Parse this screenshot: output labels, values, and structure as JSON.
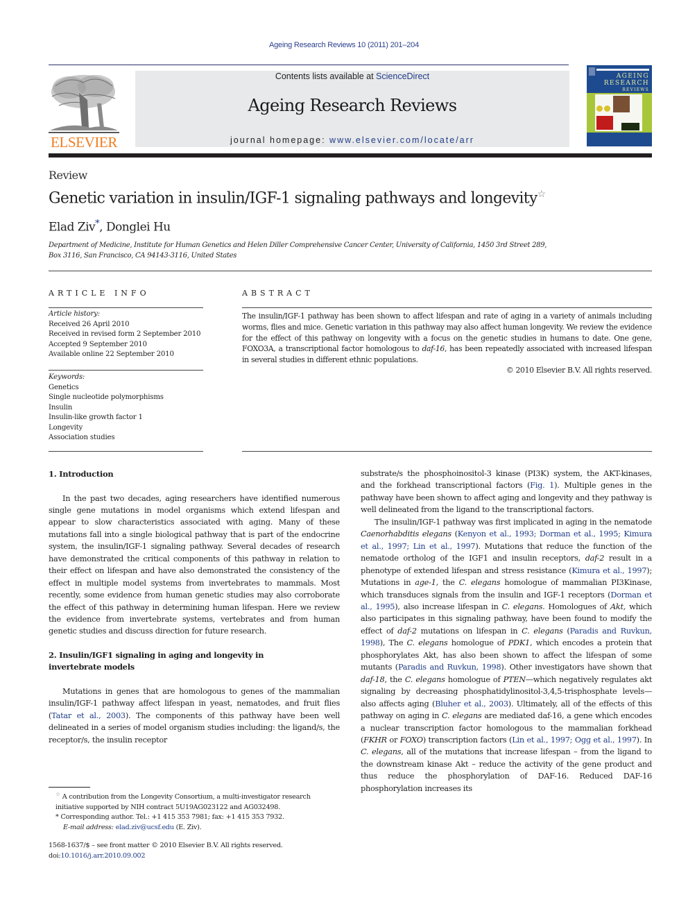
{
  "header": {
    "journal_reference": "Ageing Research Reviews 10 (2011) 201–204",
    "contents_prefix": "Contents lists available at ",
    "contents_link": "ScienceDirect",
    "journal_title": "Ageing Research Reviews",
    "homepage_prefix": "journal homepage: ",
    "homepage_link": "www.elsevier.com/locate/arr",
    "publisher_logo_text": "ELSEVIER",
    "cover": {
      "line1": "AGEING",
      "line2": "RESEARCH",
      "line3": "REVIEWS"
    },
    "colors": {
      "publisher_orange": "#f07d20",
      "link_blue": "#1f3c88",
      "banner_gray": "#e8e9ea",
      "cover_blue": "#1e4b8f",
      "cover_green": "#a8c63a"
    }
  },
  "article": {
    "type": "Review",
    "title": "Genetic variation in insulin/IGF-1 signaling pathways and longevity",
    "title_mark": "☆",
    "authors": [
      {
        "name": "Elad Ziv",
        "mark": "*"
      },
      {
        "name": "Donglei Hu",
        "mark": ""
      }
    ],
    "author_separator": ", ",
    "affiliation_line1": "Department of Medicine, Institute for Human Genetics and Helen Diller Comprehensive Cancer Center, University of California, 1450 3rd Street 289,",
    "affiliation_line2": "Box 3116, San Francisco, CA 94143-3116, United States"
  },
  "article_info": {
    "heading": "ARTICLE INFO",
    "history_label": "Article history:",
    "history": [
      "Received 26 April 2010",
      "Received in revised form 2 September 2010",
      "Accepted 9 September 2010",
      "Available online 22 September 2010"
    ],
    "keywords_label": "Keywords:",
    "keywords": [
      "Genetics",
      "Single nucleotide polymorphisms",
      "Insulin",
      "Insulin-like growth factor 1",
      "Longevity",
      "Association studies"
    ]
  },
  "abstract": {
    "heading": "ABSTRACT",
    "text_before_italic": "The insulin/IGF-1 pathway has been shown to affect lifespan and rate of aging in a variety of animals including worms, flies and mice. Genetic variation in this pathway may also affect human longevity. We review the evidence for the effect of this pathway on longevity with a focus on the genetic studies in humans to date. One gene, FOXO3A, a transcriptional factor homologous to ",
    "italic": "daf-16",
    "text_after_italic": ", has been repeatedly associated with increased lifespan in several studies in different ethnic populations.",
    "copyright": "© 2010 Elsevier B.V. All rights reserved."
  },
  "sections": {
    "intro_heading": "1.  Introduction",
    "intro_text": "In the past two decades, aging researchers have identified numerous single gene mutations in model organisms which extend lifespan and appear to slow characteristics associated with aging. Many of these mutations fall into a single biological pathway that is part of the endocrine system, the insulin/IGF-1 signaling pathway. Several decades of research have demonstrated the critical components of this pathway in relation to their effect on lifespan and have also demonstrated the consistency of the effect in multiple model systems from invertebrates to mammals. Most recently, some evidence from human genetic studies may also corroborate the effect of this pathway in determining human lifespan. Here we review the evidence from invertebrate systems, vertebrates and from human genetic studies and discuss direction for future research.",
    "sec2_heading": "2.  Insulin/IGF1 signaling in aging and longevity in invertebrate models",
    "sec2_p1_a": "Mutations in genes that are homologous to genes of the mammalian insulin/IGF-1 pathway affect lifespan in yeast, nematodes, and fruit flies (",
    "sec2_p1_cite1": "Tatar et al., 2003",
    "sec2_p1_b": "). The components of this pathway have been well delineated in a series of model organism studies including: the ligand/s, the receptor/s, the insulin receptor substrate/s the phosphoinositol-3 kinase (PI3K) system, the AKT-kinases, and the forkhead transcriptional factors (",
    "sec2_p1_cite2": "Fig. 1",
    "sec2_p1_c": "). Multiple genes in the pathway have been shown to affect aging and longevity and they pathway is well delineated from the ligand to the transcriptional factors.",
    "sec2_p2": [
      {
        "t": "The insulin/IGF-1 pathway was first implicated in aging in the nematode "
      },
      {
        "i": "Caenorhabditis elegans"
      },
      {
        "t": " ("
      },
      {
        "c": "Kenyon et al., 1993; Dorman et al., 1995; Kimura et al., 1997; Lin et al., 1997"
      },
      {
        "t": "). Mutations that reduce the function of the nematode ortholog of the IGF1 and insulin receptors, "
      },
      {
        "i": "daf-2"
      },
      {
        "t": " result in a phenotype of extended lifespan and stress resistance ("
      },
      {
        "c": "Kimura et al., 1997"
      },
      {
        "t": "); Mutations in "
      },
      {
        "i": "age-1"
      },
      {
        "t": ", the "
      },
      {
        "i": "C. elegans"
      },
      {
        "t": " homologue of mammalian PI3Kinase, which transduces signals from the insulin and IGF-1 receptors ("
      },
      {
        "c": "Dorman et al., 1995"
      },
      {
        "t": "), also increase lifespan in "
      },
      {
        "i": "C. elegans."
      },
      {
        "t": " Homologues of "
      },
      {
        "i": "Akt,"
      },
      {
        "t": " which also participates in this signaling pathway, have been found to modify the effect of "
      },
      {
        "i": "daf-2"
      },
      {
        "t": " mutations on lifespan in "
      },
      {
        "i": "C. elegans"
      },
      {
        "t": " ("
      },
      {
        "c": "Paradis and Ruvkun, 1998"
      },
      {
        "t": "), The "
      },
      {
        "i": "C. elegans"
      },
      {
        "t": " homologue of "
      },
      {
        "i": "PDK1,"
      },
      {
        "t": " which encodes a protein that phosphorylates Akt, has also been shown to affect the lifespan of some mutants ("
      },
      {
        "c": "Paradis and Ruvkun, 1998"
      },
      {
        "t": "). Other investigators have shown that "
      },
      {
        "i": "daf-18"
      },
      {
        "t": ", the "
      },
      {
        "i": "C. elegans"
      },
      {
        "t": " homologue of "
      },
      {
        "i": "PTEN"
      },
      {
        "t": "—which negatively regulates akt signaling by decreasing phosphatidylinositol-3,4,5-trisphosphate levels—also affects aging ("
      },
      {
        "c": "Bluher et al., 2003"
      },
      {
        "t": "). Ultimately, all of the effects of this pathway on aging in "
      },
      {
        "i": "C. elegans"
      },
      {
        "t": " are mediated daf-16, a gene which encodes a nuclear transcription factor homologous to the mammalian forkhead ("
      },
      {
        "i": "FKHR"
      },
      {
        "t": " or "
      },
      {
        "i": "FOXO"
      },
      {
        "t": ") transcription factors ("
      },
      {
        "c": "Lin et al., 1997; Ogg et al., 1997"
      },
      {
        "t": "). In "
      },
      {
        "i": "C. elegans"
      },
      {
        "t": ", all of the mutations that increase lifespan – from the ligand to the downstream kinase Akt – reduce the activity of the gene product and thus reduce the phosphorylation of DAF-16. Reduced DAF-16 phosphorylation increases its"
      }
    ]
  },
  "footnotes": {
    "star_mark": "☆",
    "star_text": "A contribution from the Longevity Consortium, a multi-investigator research initiative supported by NIH contract 5U19AG023122 and AG032498.",
    "corresponding_mark": "*",
    "corresponding_text": "Corresponding author. Tel.: +1 415 353 7981; fax: +1 415 353 7932.",
    "email_label": "E-mail address:",
    "email": "elad.ziv@ucsf.edu",
    "email_suffix": " (E. Ziv).",
    "front_matter": "1568-1637/$ – see front matter © 2010 Elsevier B.V. All rights reserved.",
    "doi_prefix": "doi:",
    "doi": "10.1016/j.arr.2010.09.002"
  }
}
